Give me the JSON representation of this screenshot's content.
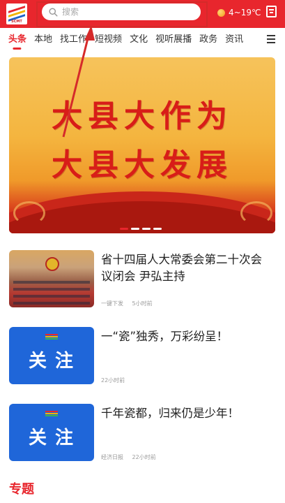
{
  "header": {
    "logo_text": "SCMT",
    "search_placeholder": "搜索",
    "weather": "4~19℃"
  },
  "tabs": [
    "头条",
    "本地",
    "找工作",
    "短视频",
    "文化",
    "视听展播",
    "政务",
    "资讯"
  ],
  "banner": {
    "line1": "大县大作为",
    "line2": "大县大发展",
    "slides": 4,
    "active_slide": 0
  },
  "news": [
    {
      "title": "省十四届人大常委会第二十次会议闭会 尹弘主持",
      "source": "一键下发",
      "time": "5小时前",
      "thumb": "photo"
    },
    {
      "title": "一“瓷”独秀，万彩纷呈！",
      "thumb_text": "关注",
      "time": "22小时前",
      "thumb": "blue"
    },
    {
      "title": "千年瓷都，归来仍是少年！",
      "thumb_text": "关注",
      "source": "经济日报",
      "time": "22小时前",
      "thumb": "blue"
    }
  ],
  "section": {
    "title": "专题"
  },
  "colors": {
    "brand": "#e8262d",
    "blue_card": "#1f66d9"
  }
}
